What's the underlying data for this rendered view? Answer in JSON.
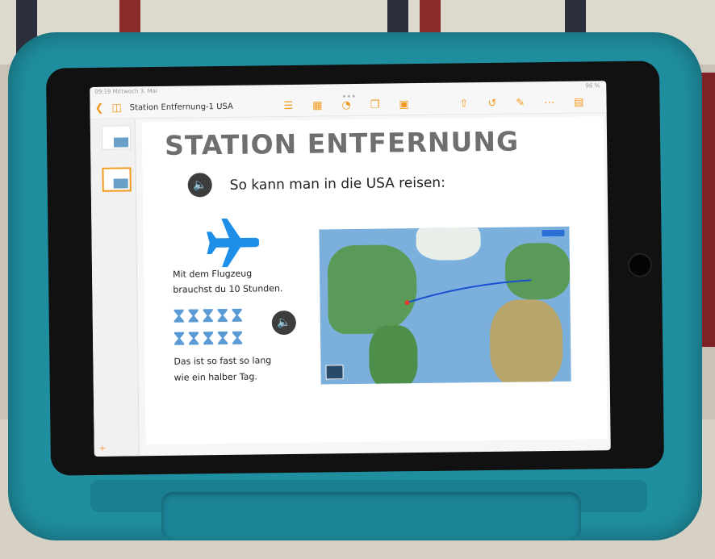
{
  "status": {
    "time": "09:19  Mittwoch 3. Mai",
    "battery": "96 %"
  },
  "toolbar": {
    "back_icon": "chevron-left-icon",
    "sidebar_icon": "sidebar-icon",
    "doc_title": "Station Entfernung-1 USA"
  },
  "slide": {
    "title": "STATION ENTFERNUNG",
    "subtitle": "So kann man in die USA reisen:",
    "line1": "Mit dem Flugzeug",
    "line2": "brauchst du 10 Stunden.",
    "line3": "Das ist so fast so lang",
    "line4": "wie ein halber Tag.",
    "hourglass_count": 10
  },
  "colors": {
    "accent": "#f09a1e",
    "plane": "#1e8fe8",
    "hourglass": "#5a9bd6",
    "case": "#1f8fa0"
  }
}
